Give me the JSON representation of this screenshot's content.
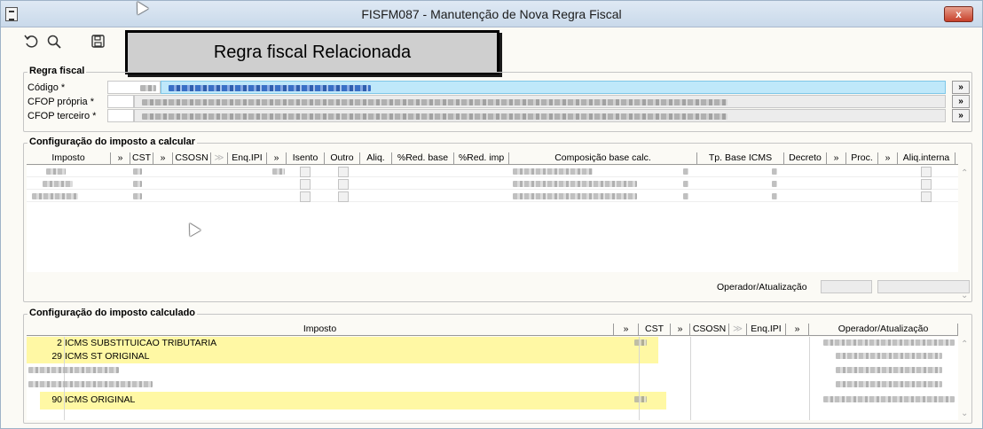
{
  "window": {
    "title": "FISFM087 - Manutenção de Nova Regra Fiscal",
    "close_label": "x"
  },
  "toolbar": {
    "icons": [
      "undo-icon",
      "search-icon",
      "save-icon"
    ]
  },
  "banner": {
    "text": "Regra fiscal Relacionada"
  },
  "regra_fiscal": {
    "legend": "Regra fiscal",
    "rows": [
      {
        "label": "Código *",
        "more": "»"
      },
      {
        "label": "CFOP própria *",
        "more": "»"
      },
      {
        "label": "CFOP terceiro *",
        "more": "»"
      }
    ]
  },
  "config_calcular": {
    "legend": "Configuração do imposto a calcular",
    "columns": [
      {
        "label": "Imposto"
      },
      {
        "label": "»"
      },
      {
        "label": "CST"
      },
      {
        "label": "»"
      },
      {
        "label": "CSOSN"
      },
      {
        "label": "≫"
      },
      {
        "label": "Enq.IPI"
      },
      {
        "label": "»"
      },
      {
        "label": "Isento"
      },
      {
        "label": "Outro"
      },
      {
        "label": "Aliq."
      },
      {
        "label": "%Red. base"
      },
      {
        "label": "%Red. imp"
      },
      {
        "label": "Composição base calc."
      },
      {
        "label": "Tp. Base ICMS"
      },
      {
        "label": "Decreto"
      },
      {
        "label": "»"
      },
      {
        "label": "Proc."
      },
      {
        "label": "»"
      },
      {
        "label": "Aliq.interna"
      }
    ],
    "operator_label": "Operador/Atualização"
  },
  "config_calculado": {
    "legend": "Configuração do imposto calculado",
    "columns": [
      {
        "label": "Imposto"
      },
      {
        "label": "»"
      },
      {
        "label": "CST"
      },
      {
        "label": "»"
      },
      {
        "label": "CSOSN"
      },
      {
        "label": "≫"
      },
      {
        "label": "Enq.IPI"
      },
      {
        "label": "»"
      },
      {
        "label": "Operador/Atualização"
      }
    ],
    "rows": [
      {
        "code": "2",
        "name": "ICMS SUBSTITUICAO TRIBUTARIA",
        "highlighted": true
      },
      {
        "code": "29",
        "name": "ICMS ST ORIGINAL",
        "highlighted": true
      },
      {
        "code": "",
        "name": "",
        "highlighted": false
      },
      {
        "code": "",
        "name": "",
        "highlighted": false
      },
      {
        "code": "90",
        "name": "ICMS ORIGINAL",
        "highlighted": true
      }
    ]
  },
  "colors": {
    "highlight": "#fff79a",
    "selection": "#bfe8fa",
    "close_button": "#c7402a"
  }
}
